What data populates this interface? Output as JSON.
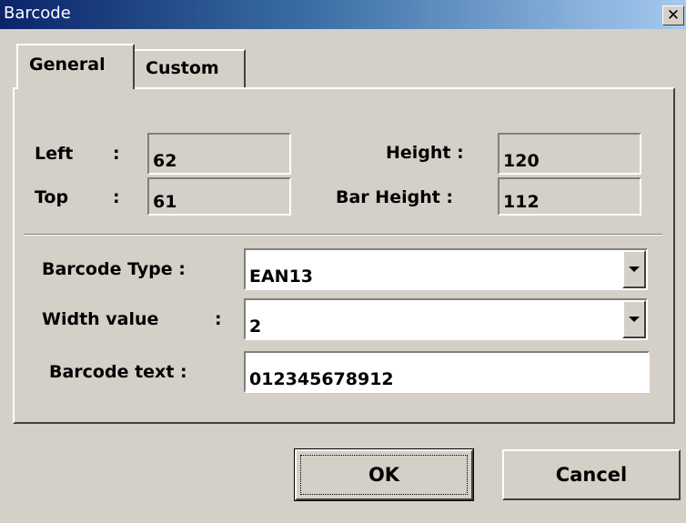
{
  "window": {
    "title": "Barcode",
    "close_label": "✕"
  },
  "tabs": [
    {
      "label": "General",
      "active": true
    },
    {
      "label": "Custom",
      "active": false
    }
  ],
  "position": {
    "left_label": "Left",
    "left_colon": ":",
    "left_value": "62",
    "top_label": "Top",
    "top_colon": ":",
    "top_value": "61",
    "height_label": "Height :",
    "height_value": "120",
    "bar_height_label": "Bar Height :",
    "bar_height_value": "112"
  },
  "barcode": {
    "type_label": "Barcode Type :",
    "type_value": "EAN13",
    "width_label": "Width value",
    "width_colon": ":",
    "width_value": "2",
    "text_label": "Barcode text :",
    "text_value": "012345678912"
  },
  "buttons": {
    "ok_label": "OK",
    "cancel_label": "Cancel"
  },
  "colors": {
    "face": "#d4d0c8",
    "title_start": "#0a246a",
    "title_end": "#a6caf0"
  }
}
